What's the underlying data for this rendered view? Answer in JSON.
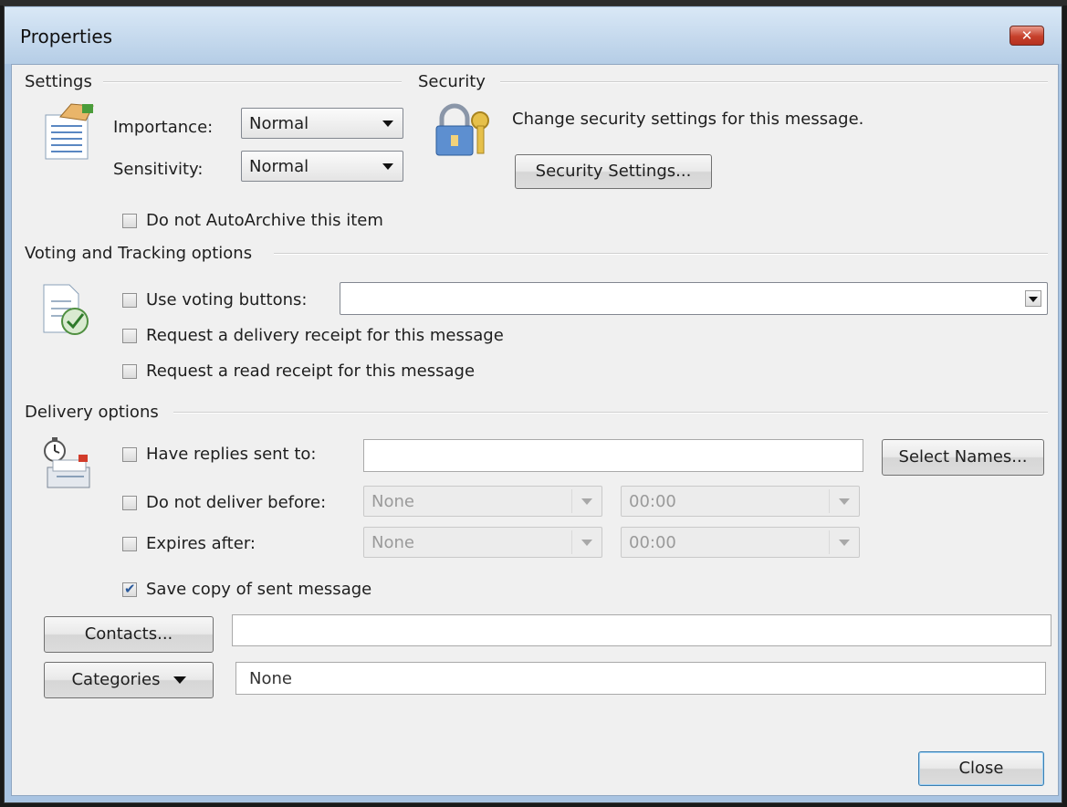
{
  "window": {
    "title": "Properties",
    "close_icon": "close-icon"
  },
  "settings": {
    "heading": "Settings",
    "importance_label": "Importance:",
    "importance_value": "Normal",
    "sensitivity_label": "Sensitivity:",
    "sensitivity_value": "Normal",
    "autoarchive_label": "Do not AutoArchive this item",
    "autoarchive_checked": false
  },
  "security": {
    "heading": "Security",
    "description": "Change security settings for this message.",
    "button_label": "Security Settings..."
  },
  "voting": {
    "heading": "Voting and Tracking options",
    "use_voting_label": "Use voting buttons:",
    "use_voting_checked": false,
    "use_voting_value": "",
    "delivery_receipt_label": "Request a delivery receipt for this message",
    "delivery_receipt_checked": false,
    "read_receipt_label": "Request a read receipt for this message",
    "read_receipt_checked": false
  },
  "delivery": {
    "heading": "Delivery options",
    "replies_label": "Have replies sent to:",
    "replies_checked": false,
    "replies_value": "",
    "select_names_label": "Select Names...",
    "not_before_label": "Do not deliver before:",
    "not_before_checked": false,
    "not_before_date": "None",
    "not_before_time": "00:00",
    "expires_label": "Expires after:",
    "expires_checked": false,
    "expires_date": "None",
    "expires_time": "00:00",
    "save_copy_label": "Save copy of sent message",
    "save_copy_checked": true
  },
  "contacts": {
    "button_label": "Contacts...",
    "value": ""
  },
  "categories": {
    "button_label": "Categories",
    "value": "None"
  },
  "footer": {
    "close_label": "Close"
  },
  "colors": {
    "title_bar": "#b5cde6",
    "close_button": "#c6402b",
    "dialog_bg": "#f0f0f0",
    "check_mark": "#2a5a9c"
  }
}
